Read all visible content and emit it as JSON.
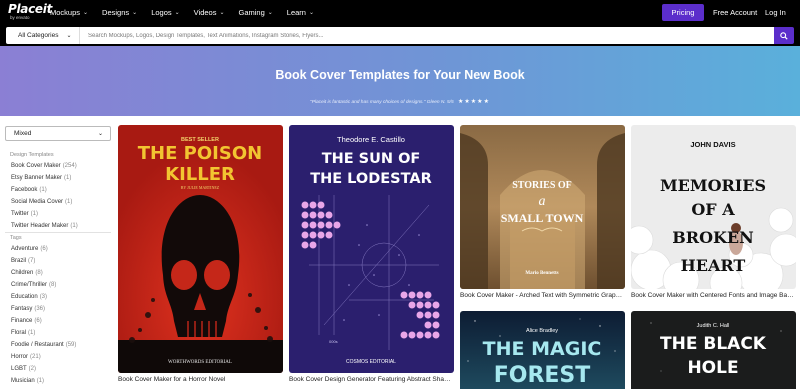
{
  "nav": {
    "logo": "Placeit",
    "logo_sub": "by envato",
    "menu": [
      {
        "label": "Mockups"
      },
      {
        "label": "Designs"
      },
      {
        "label": "Logos"
      },
      {
        "label": "Videos"
      },
      {
        "label": "Gaming"
      },
      {
        "label": "Learn"
      }
    ],
    "pricing": "Pricing",
    "free_account": "Free Account",
    "login": "Log In"
  },
  "search": {
    "category": "All Categories",
    "placeholder": "Search Mockups, Logos, Design Templates, Text Animations, Instagram Stories, Flyers..."
  },
  "banner": {
    "title": "Book Cover Templates for Your New Book",
    "quote": "\"Placeit is fantastic and has many choices of designs.\"  Gleen N. 5/5",
    "stars": "★★★★★"
  },
  "sidebar": {
    "sort": "Mixed",
    "design_heading": "Design Templates",
    "design_items": [
      {
        "label": "Book Cover Maker",
        "count": "(254)"
      },
      {
        "label": "Etsy Banner Maker",
        "count": "(1)"
      },
      {
        "label": "Facebook",
        "count": "(1)"
      },
      {
        "label": "Social Media Cover",
        "count": "(1)"
      },
      {
        "label": "Twitter",
        "count": "(1)"
      },
      {
        "label": "Twitter Header Maker",
        "count": "(1)"
      }
    ],
    "tags_heading": "Tags",
    "tag_items": [
      {
        "label": "Adventure",
        "count": "(6)"
      },
      {
        "label": "Brazil",
        "count": "(7)"
      },
      {
        "label": "Children",
        "count": "(8)"
      },
      {
        "label": "Crime/Thriller",
        "count": "(8)"
      },
      {
        "label": "Education",
        "count": "(3)"
      },
      {
        "label": "Fantasy",
        "count": "(36)"
      },
      {
        "label": "Finance",
        "count": "(6)"
      },
      {
        "label": "Floral",
        "count": "(1)"
      },
      {
        "label": "Foodie / Restaurant",
        "count": "(59)"
      },
      {
        "label": "Horror",
        "count": "(21)"
      },
      {
        "label": "LGBT",
        "count": "(2)"
      },
      {
        "label": "Musician",
        "count": "(1)"
      }
    ]
  },
  "cards": {
    "horror": {
      "caption": "Book Cover Maker for a Horror Novel",
      "kicker": "BEST SELLER",
      "title1": "THE POISON",
      "title2": "KILLER",
      "author": "BY JULIE MARTINEZ",
      "publisher": "WORTHWORDS EDITORIAL"
    },
    "lodestar": {
      "caption": "Book Cover Design Generator Featuring Abstract Shapes",
      "author": "Theodore E. Castillo",
      "title1": "THE SUN OF",
      "title2": "THE LODESTAR",
      "note": "000s",
      "publisher": "COSMOS EDITORIAL"
    },
    "smalltown": {
      "caption": "Book Cover Maker - Arched Text with Symmetric Graphics",
      "line1": "STORIES OF",
      "line2": "a",
      "line3": "SMALL TOWN",
      "author": "Mario Bennetts"
    },
    "memories": {
      "caption": "Book Cover Maker with Centered Fonts and Image Background",
      "author": "JOHN DAVIS",
      "line1": "MEMORIES",
      "line2": "OF A",
      "line3": "BROKEN",
      "line4": "HEART"
    },
    "forest": {
      "author": "Alice Bradley",
      "title1": "THE MAGIC",
      "title2": "FOREST"
    },
    "blackhole": {
      "author": "Judith C. Hall",
      "title1": "THE BLACK",
      "title2": "HOLE"
    }
  },
  "colors": {
    "accent": "#5b2ecb",
    "banner_start": "#8b7fd4",
    "banner_end": "#5ab0db",
    "horror_bg": "#c8241a",
    "horror_title": "#f2c531",
    "lodestar_bg": "#2b1f6e",
    "lodestar_dots": "#e9a6e8"
  }
}
